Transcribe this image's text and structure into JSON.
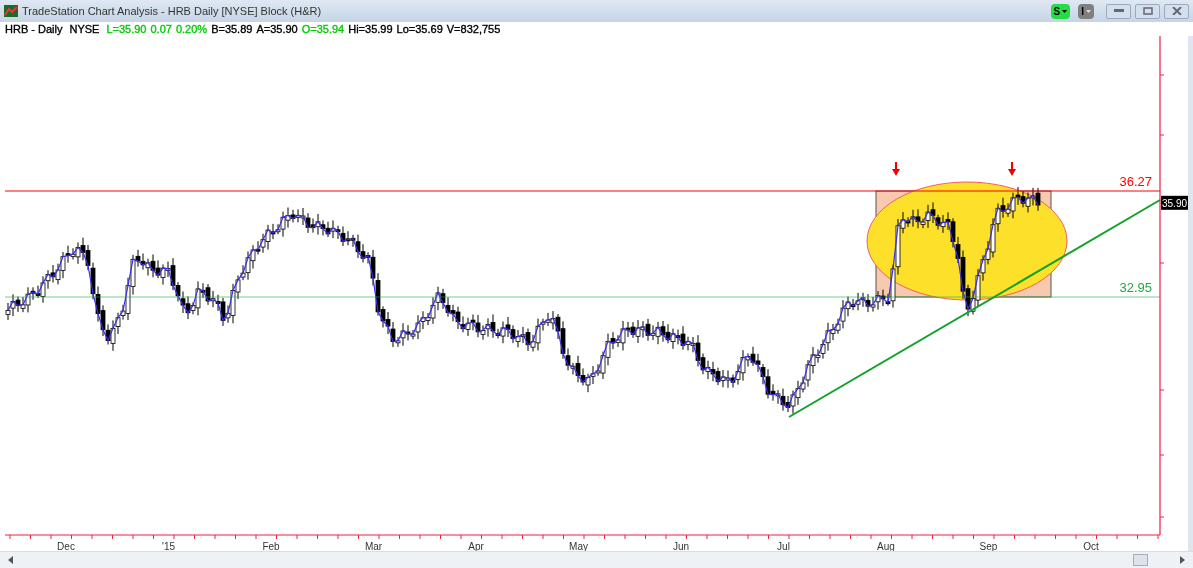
{
  "window": {
    "title": "TradeStation Chart Analysis - HRB Daily [NYSE] Block (H&R)"
  },
  "toolbar": {
    "buttons": [
      {
        "label": "S",
        "color": "#22dd44"
      },
      {
        "label": "I",
        "color": "#808080"
      }
    ]
  },
  "quote_bar": {
    "items": [
      {
        "text": "HRB - Daily",
        "color": "#000000"
      },
      {
        "text": "NYSE",
        "color": "#000000"
      },
      {
        "text": "L=35.90",
        "color": "#00cc00"
      },
      {
        "text": "0.07",
        "color": "#00cc00"
      },
      {
        "text": "0.20%",
        "color": "#00cc00"
      },
      {
        "text": "B=35.89",
        "color": "#000000"
      },
      {
        "text": "A=35.90",
        "color": "#000000"
      },
      {
        "text": "O=35.94",
        "color": "#00cc00"
      },
      {
        "text": "Hi=35.99",
        "color": "#000000"
      },
      {
        "text": "Lo=35.69",
        "color": "#000000"
      },
      {
        "text": "V=832,755",
        "color": "#000000"
      }
    ]
  },
  "chart": {
    "price_levels": [
      {
        "label": "36.27",
        "color": "#ff0000"
      },
      {
        "label": "32.95",
        "color": "#22aa44"
      }
    ],
    "last_price": "35.90",
    "x_axis_labels": [
      "Dec",
      "'15",
      "Feb",
      "Mar",
      "Apr",
      "May",
      "Jun",
      "Jul",
      "Aug",
      "Sep",
      "Oct"
    ]
  }
}
